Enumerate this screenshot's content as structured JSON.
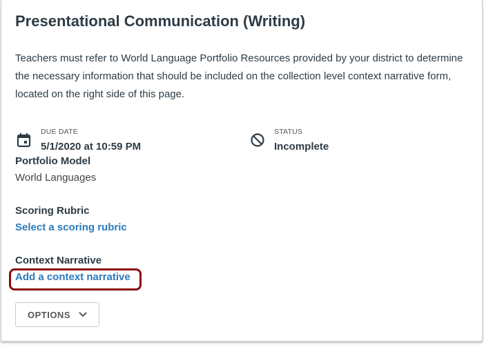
{
  "title": "Presentational Communication (Writing)",
  "description": "Teachers must refer to World Language Portfolio Resources provided by your district to determine the necessary information that should be included on the collection level context narrative form, located on the right side of this page.",
  "due_date": {
    "label": "DUE DATE",
    "value": "5/1/2020 at 10:59 PM",
    "icon": "calendar-icon"
  },
  "status": {
    "label": "STATUS",
    "value": "Incomplete",
    "icon": "no-entry-icon"
  },
  "portfolio_model": {
    "heading": "Portfolio Model",
    "value": "World Languages"
  },
  "scoring_rubric": {
    "heading": "Scoring Rubric",
    "link": "Select a scoring rubric"
  },
  "context_narrative": {
    "heading": "Context Narrative",
    "link": "Add a context narrative"
  },
  "options_button": {
    "label": "OPTIONS",
    "icon": "chevron-down-icon"
  },
  "colors": {
    "link": "#2b7abc",
    "highlight": "#8b0a0a"
  }
}
